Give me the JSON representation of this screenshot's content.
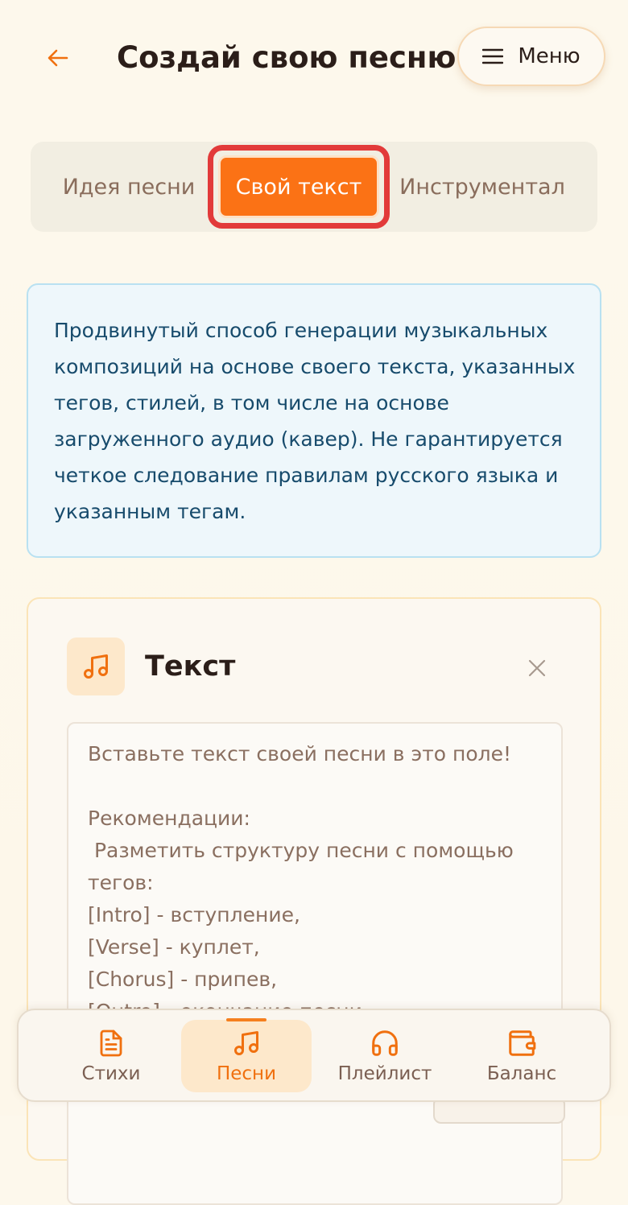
{
  "header": {
    "title": "Создай свою песню",
    "menu_label": "Меню",
    "back_icon": "arrow-left-icon",
    "menu_icon": "hamburger-icon"
  },
  "tabs": [
    {
      "label": "Идея песни",
      "active": false
    },
    {
      "label": "Свой текст",
      "active": true
    },
    {
      "label": "Инструментал",
      "active": false
    }
  ],
  "info": {
    "text": "Продвинутый способ генерации музыкальных композиций на основе своего текста, указанных тегов, стилей, в том числе на основе загруженного аудио (кавер). Не гарантируется четкое следование правилам русского языка и указанным тегам."
  },
  "lyrics_card": {
    "title": "Текст",
    "icon": "music-note-icon",
    "close_icon": "close-icon",
    "placeholder": "Вставьте текст своей песни в это поле!\n\nРекомендации:\n Разметить структуру песни с помощью тегов:\n[Intro] - вступление,\n[Verse] - куплет,\n[Chorus] - припев,\n[Outro] - окончание песни"
  },
  "bottom_nav": [
    {
      "label": "Стихи",
      "icon": "document-icon",
      "active": false
    },
    {
      "label": "Песни",
      "icon": "music-note-icon",
      "active": true
    },
    {
      "label": "Плейлист",
      "icon": "headphones-icon",
      "active": false
    },
    {
      "label": "Баланс",
      "icon": "wallet-icon",
      "active": false
    }
  ],
  "colors": {
    "accent": "#fb7215",
    "highlight_border": "#e23a3a",
    "info_bg": "#eef7fb",
    "info_text": "#174b6c"
  }
}
